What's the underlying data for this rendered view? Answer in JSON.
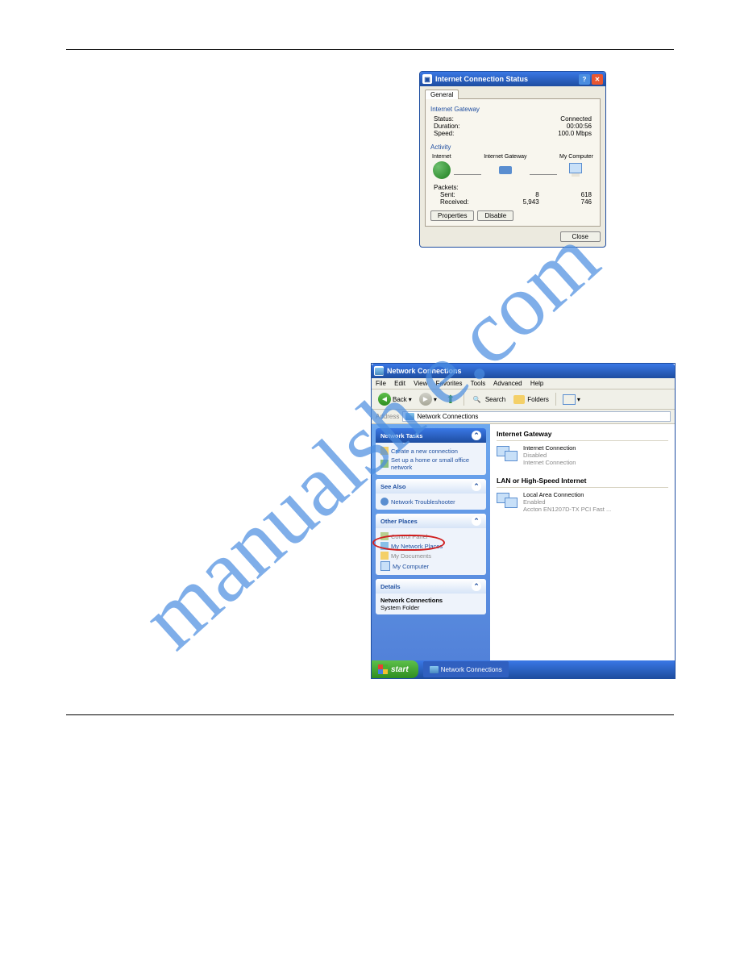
{
  "watermark": "manualsh   e.com",
  "dlg1": {
    "title": "Internet Connection Status",
    "tab": "General",
    "group_gateway": "Internet Gateway",
    "status_l": "Status:",
    "status_v": "Connected",
    "duration_l": "Duration:",
    "duration_v": "00:00:56",
    "speed_l": "Speed:",
    "speed_v": "100.0 Mbps",
    "group_activity": "Activity",
    "col_internet": "Internet",
    "col_gateway": "Internet Gateway",
    "col_computer": "My Computer",
    "packets_l": "Packets:",
    "sent_l": "Sent:",
    "sent_gw": "8",
    "sent_pc": "618",
    "recv_l": "Received:",
    "recv_gw": "5,943",
    "recv_pc": "746",
    "btn_properties": "Properties",
    "btn_disable": "Disable",
    "btn_close": "Close"
  },
  "win2": {
    "title": "Network Connections",
    "menu": {
      "file": "File",
      "edit": "Edit",
      "view": "View",
      "favorites": "Favorites",
      "tools": "Tools",
      "advanced": "Advanced",
      "help": "Help"
    },
    "toolbar": {
      "back": "Back",
      "search": "Search",
      "folders": "Folders"
    },
    "address_l": "Address",
    "address_v": "Network Connections",
    "panels": {
      "network_tasks": "Network Tasks",
      "nt_create": "Create a new connection",
      "nt_setup": "Set up a home or small office network",
      "see_also": "See Also",
      "sa_trouble": "Network Troubleshooter",
      "other_places": "Other Places",
      "op_cp": "Control Panel",
      "op_mnp": "My Network Places",
      "op_docs": "My Documents",
      "op_comp": "My Computer",
      "details": "Details",
      "det_name": "Network Connections",
      "det_type": "System Folder"
    },
    "content": {
      "cat1": "Internet Gateway",
      "ic_name": "Internet Connection",
      "ic_state": "Disabled",
      "ic_sub": "Internet Connection",
      "cat2": "LAN or High-Speed Internet",
      "lan_name": "Local Area Connection",
      "lan_state": "Enabled",
      "lan_sub": "Accton EN1207D-TX PCI Fast ..."
    },
    "start": "start",
    "task": "Network Connections"
  }
}
